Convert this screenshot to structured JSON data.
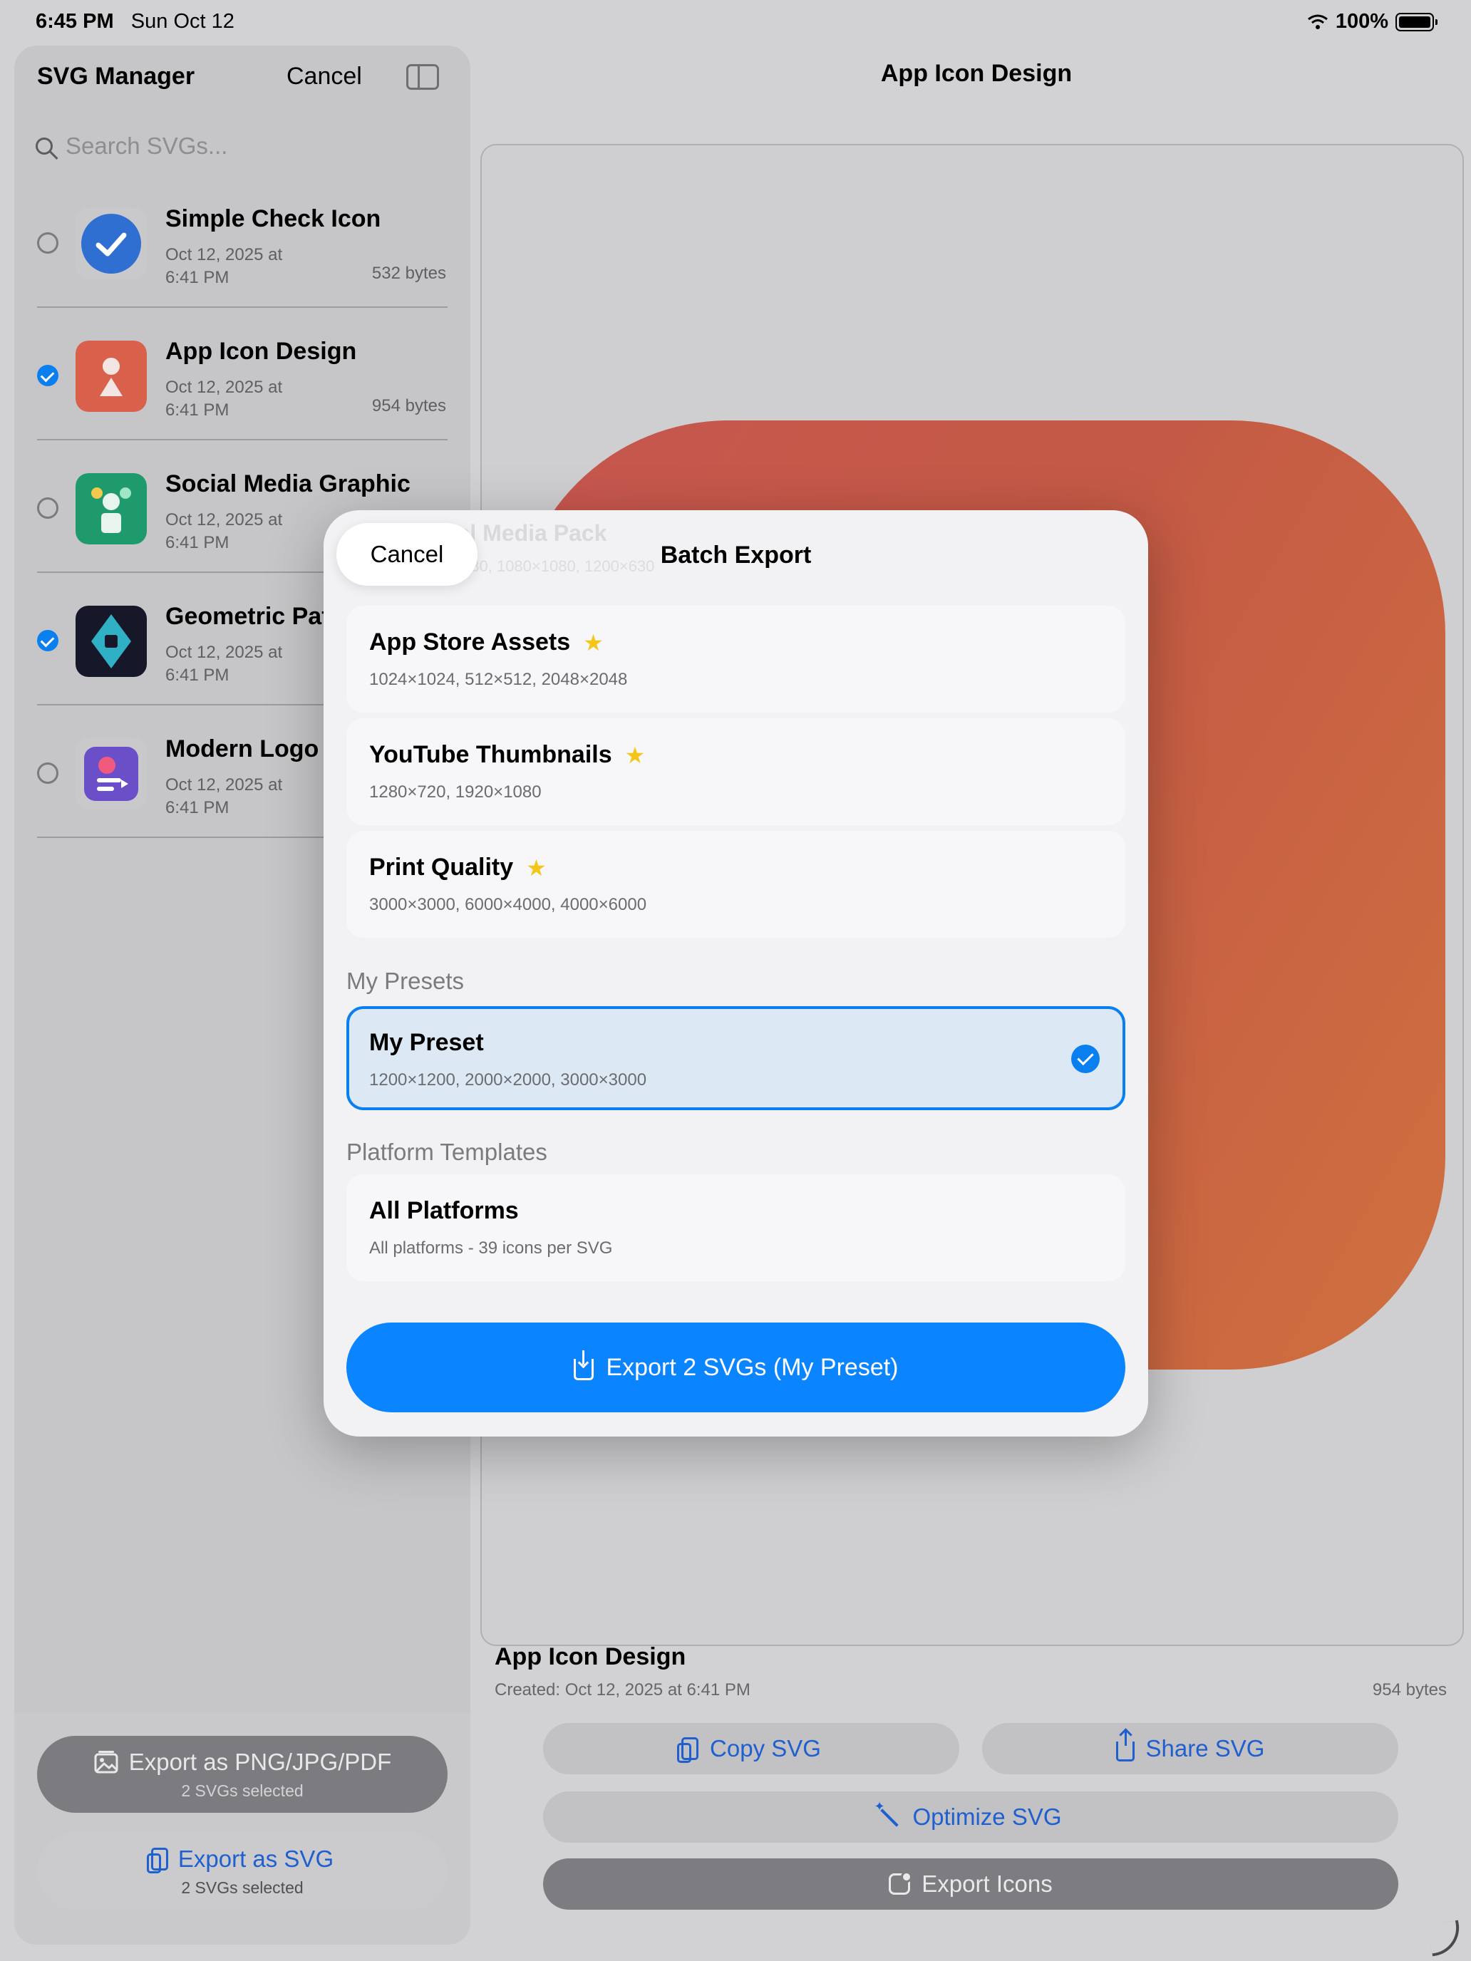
{
  "status_bar": {
    "time": "6:45 PM",
    "date": "Sun Oct 12",
    "battery": "100%"
  },
  "sidebar": {
    "title": "SVG Manager",
    "cancel_label": "Cancel",
    "search_placeholder": "Search SVGs...",
    "items": [
      {
        "name": "Simple Check Icon",
        "date_line1": "Oct 12, 2025 at",
        "date_line2": "6:41 PM",
        "size": "532 bytes",
        "selected": false
      },
      {
        "name": "App Icon Design",
        "date_line1": "Oct 12, 2025 at",
        "date_line2": "6:41 PM",
        "size": "954 bytes",
        "selected": true
      },
      {
        "name": "Social Media Graphic",
        "date_line1": "Oct 12, 2025 at",
        "date_line2": "6:41 PM",
        "size": "",
        "selected": false
      },
      {
        "name": "Geometric Pat",
        "date_line1": "Oct 12, 2025 at",
        "date_line2": "6:41 PM",
        "size": "",
        "selected": true
      },
      {
        "name": "Modern Logo",
        "date_line1": "Oct 12, 2025 at",
        "date_line2": "6:41 PM",
        "size": "",
        "selected": false
      }
    ],
    "export_png_label": "Export as PNG/JPG/PDF",
    "export_png_sub": "2 SVGs selected",
    "export_svg_label": "Export as SVG",
    "export_svg_sub": "2 SVGs selected"
  },
  "main": {
    "title": "App Icon Design",
    "info_name": "App Icon Design",
    "info_created": "Created: Oct 12, 2025 at 6:41 PM",
    "info_size": "954 bytes",
    "copy_label": "Copy SVG",
    "share_label": "Share SVG",
    "optimize_label": "Optimize SVG",
    "export_icons_label": "Export Icons"
  },
  "modal": {
    "title": "Batch Export",
    "cancel_label": "Cancel",
    "ghost_name": "Social Media Pack",
    "ghost_sizes": "1080×1080, 1080×1080, 1200×630",
    "builtin": [
      {
        "name": "App Store Assets",
        "sizes": "1024×1024, 512×512, 2048×2048"
      },
      {
        "name": "YouTube Thumbnails",
        "sizes": "1280×720, 1920×1080"
      },
      {
        "name": "Print Quality",
        "sizes": "3000×3000, 6000×4000, 4000×6000"
      }
    ],
    "my_presets_label": "My Presets",
    "my_preset": {
      "name": "My Preset",
      "sizes": "1200×1200, 2000×2000, 3000×3000",
      "selected": true
    },
    "platform_label": "Platform Templates",
    "platform": {
      "name": "All Platforms",
      "desc": "All platforms - 39 icons per SVG"
    },
    "export_label": "Export 2 SVGs (My Preset)"
  },
  "colors": {
    "accent": "#0a84ff",
    "star": "#f5c518",
    "icon_main": "#c7564f"
  }
}
